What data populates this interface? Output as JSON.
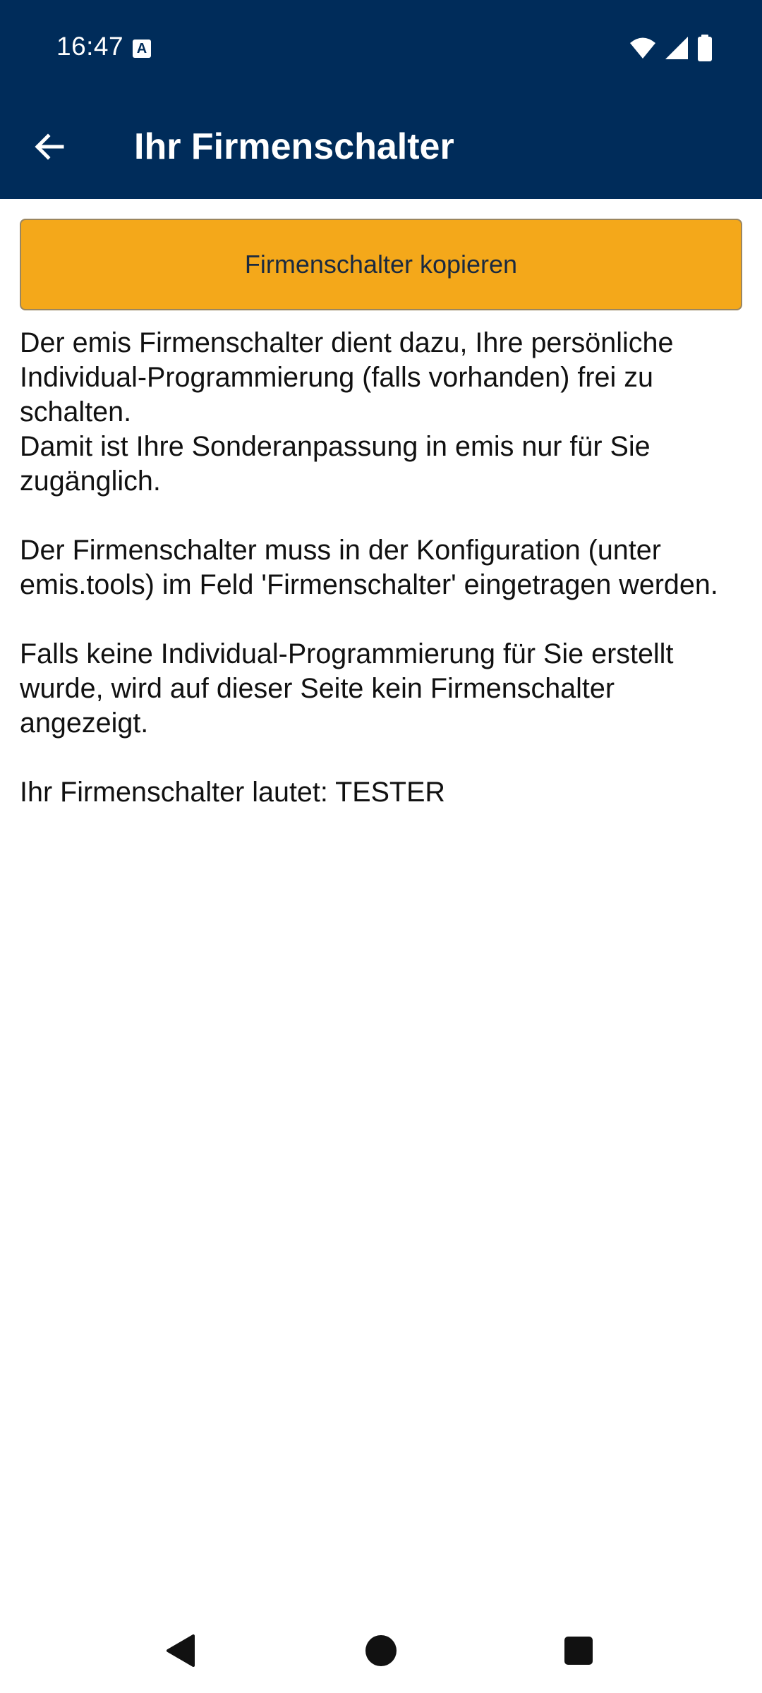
{
  "status_bar": {
    "time": "16:47",
    "notification_icon": "a-notification-icon",
    "icons": [
      "wifi-icon",
      "signal-icon",
      "battery-icon"
    ]
  },
  "app_bar": {
    "title": "Ihr Firmenschalter",
    "back_icon": "arrow-left-icon",
    "background_color": "#002c5a"
  },
  "copy_button": {
    "label": "Firmenschalter kopieren",
    "color": "#f4a81a"
  },
  "content": {
    "para1_line1": "Der emis Firmenschalter dient dazu, Ihre persönliche Individual-Programmierung (falls vorhanden) frei zu schalten.",
    "para1_line2": "Damit ist Ihre Sonderanpassung in emis nur für Sie zugänglich.",
    "para2": "Der Firmenschalter muss in der Konfiguration (unter emis.tools) im Feld 'Firmenschalter' eingetragen werden.",
    "para3": "Falls keine Individual-Programmierung für Sie erstellt wurde, wird auf dieser Seite kein Firmenschalter angezeigt.",
    "result": "Ihr Firmenschalter lautet: TESTER"
  },
  "nav_bar": {
    "buttons": [
      "back-triangle-icon",
      "home-circle-icon",
      "recents-square-icon"
    ]
  }
}
